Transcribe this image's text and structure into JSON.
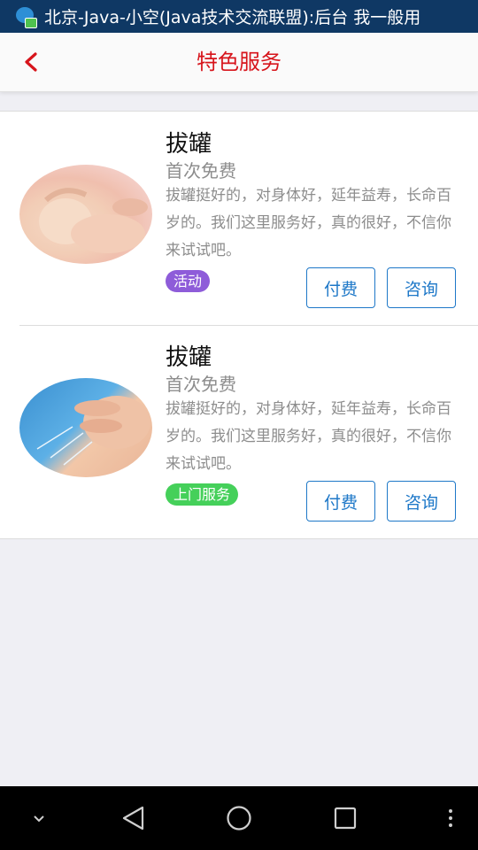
{
  "status_bar": {
    "notification_text": "北京-Java-小空(Java技术交流联盟):后台 我一般用",
    "icon": "chat-bubble-icon"
  },
  "header": {
    "title": "特色服务",
    "back_icon": "chevron-left-icon"
  },
  "colors": {
    "accent_red": "#d7141b",
    "button_blue": "#1e78c8",
    "tag_purple": "#8e5cd9",
    "tag_green": "#45d05a"
  },
  "services": [
    {
      "title": "拔罐",
      "subtitle": "首次免费",
      "description": "拔罐挺好的，对身体好，延年益寿，长命百岁的。我们这里服务好，真的很好，不信你来试试吧。",
      "tag": "活动",
      "pay_label": "付费",
      "consult_label": "咨询"
    },
    {
      "title": "拔罐",
      "subtitle": "首次免费",
      "description": "拔罐挺好的，对身体好，延年益寿，长命百岁的。我们这里服务好，真的很好，不信你来试试吧。",
      "tag": "上门服务",
      "pay_label": "付费",
      "consult_label": "咨询"
    }
  ],
  "nav_bar": {
    "items": [
      "chevron-down-icon",
      "back-triangle-icon",
      "home-circle-icon",
      "recents-square-icon",
      "more-vertical-icon"
    ]
  }
}
